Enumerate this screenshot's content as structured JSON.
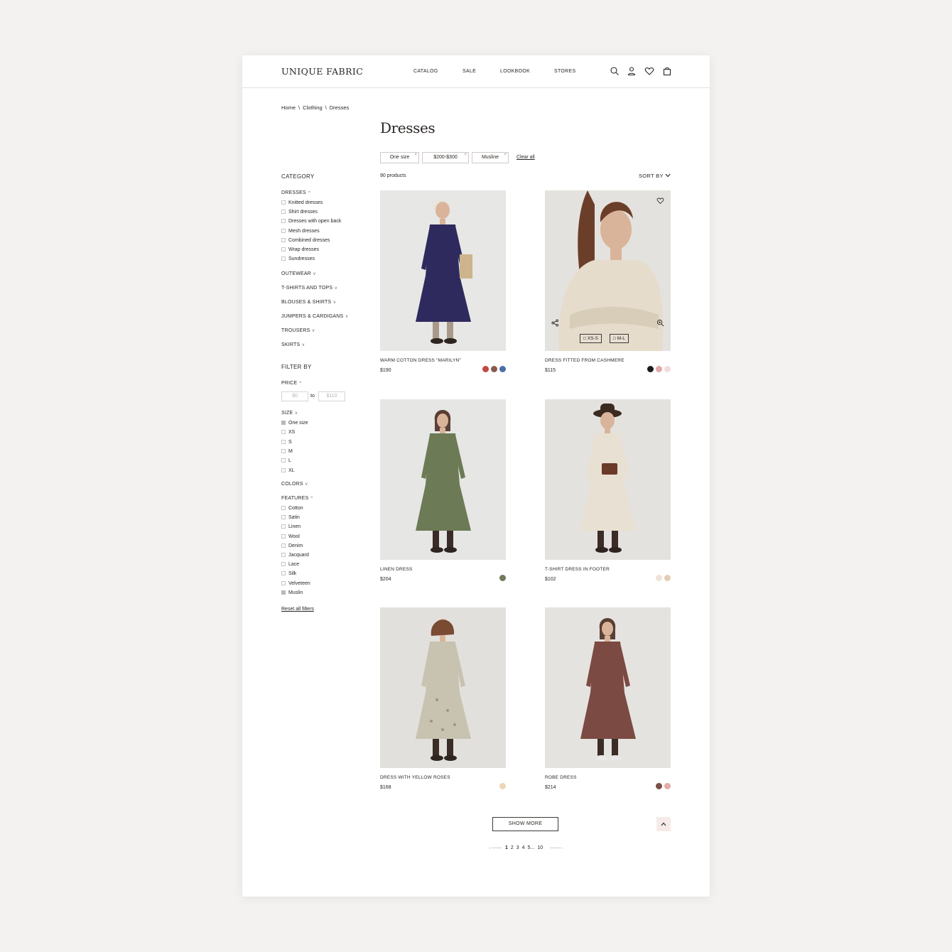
{
  "header": {
    "logo": "UNIQUE FABRIC",
    "nav": [
      "CATALOG",
      "SALE",
      "LOOKBOOK",
      "STORES"
    ],
    "icons": [
      "search-icon",
      "user-icon",
      "heart-icon",
      "bag-icon"
    ]
  },
  "breadcrumb": [
    "Home",
    "Clothing",
    "Dresses"
  ],
  "page_title": "Dresses",
  "active_filters": {
    "chips": [
      "One size",
      "$200-$300",
      "Musline"
    ],
    "clear_all": "Clear all"
  },
  "sidebar": {
    "category_heading": "CATEGORY",
    "dresses_label": "DRESSES",
    "dress_types": [
      "Knitted dresses",
      "Shirt dresses",
      "Dresses with open back",
      "Mesh dresses",
      "Combined dresses",
      "Wrap dresses",
      "Sundresses"
    ],
    "categories": [
      "OUTEWEAR",
      "T-SHIRTS AND TOPS",
      "BLOUSES & SHIRTS",
      "JUMPERS & CARDIGANS",
      "TROUSERS",
      "SKIRTS"
    ],
    "filter_heading": "FILTER BY",
    "price": {
      "label": "PRICE",
      "from_placeholder": "$0",
      "to_label": "to",
      "to_placeholder": "$110"
    },
    "size": {
      "label": "SIZE",
      "options": [
        "One size",
        "XS",
        "S",
        "M",
        "L",
        "XL"
      ],
      "checked": [
        true,
        false,
        false,
        false,
        false,
        false
      ]
    },
    "colors_label": "COLORS",
    "features": {
      "label": "FEATURES",
      "options": [
        "Cotton",
        "Satin",
        "Linen",
        "Wool",
        "Denim",
        "Jacquard",
        "Lace",
        "Silk",
        "Velveteen",
        "Muslin"
      ],
      "checked": [
        false,
        false,
        false,
        false,
        false,
        false,
        false,
        false,
        false,
        true
      ]
    },
    "reset": "Reset all filters"
  },
  "listing": {
    "count": "90 products",
    "sort_label": "SORT BY"
  },
  "products": [
    {
      "name": "WARM COTTON DRESS \"MARILYN\"",
      "price": "$190",
      "swatches": [
        "#c04a44",
        "#8a5a4c",
        "#4a6ea8"
      ],
      "bg": "#e7e7e5",
      "dress": "#2e2a5e"
    },
    {
      "name": "DRESS FITTED FROM CASHMERE",
      "price": "$115",
      "swatches": [
        "#1e1b1a",
        "#e3a9a9",
        "#f3dcdc"
      ],
      "bg": "#e4e2de",
      "dress": "#e6dccb",
      "sizes": [
        "XS-S",
        "M-L"
      ]
    },
    {
      "name": "LINEN DRESS",
      "price": "$204",
      "swatches": [
        "#6f7a5e"
      ],
      "bg": "#e6e6e4",
      "dress": "#6c7a55"
    },
    {
      "name": "T-SHIRT DRESS IN FOOTER",
      "price": "$102",
      "swatches": [
        "#efe3d7",
        "#e3cdb4"
      ],
      "bg": "#e4e2de",
      "dress": "#e8e0d2"
    },
    {
      "name": "DRESS WITH YELLOW ROSES",
      "price": "$168",
      "swatches": [
        "#ecd5b8"
      ],
      "bg": "#e2e0dc",
      "dress": "#c8c2b0"
    },
    {
      "name": "ROBE DRESS",
      "price": "$214",
      "swatches": [
        "#7a5047",
        "#e3aaa6"
      ],
      "bg": "#e5e3e0",
      "dress": "#7b4a42"
    }
  ],
  "show_more": "SHOW MORE",
  "scroll_top_icon": "chevron-up-icon",
  "pagination": {
    "pages": [
      "1",
      "2",
      "3",
      "4",
      "5...",
      "10"
    ],
    "current": "1"
  }
}
